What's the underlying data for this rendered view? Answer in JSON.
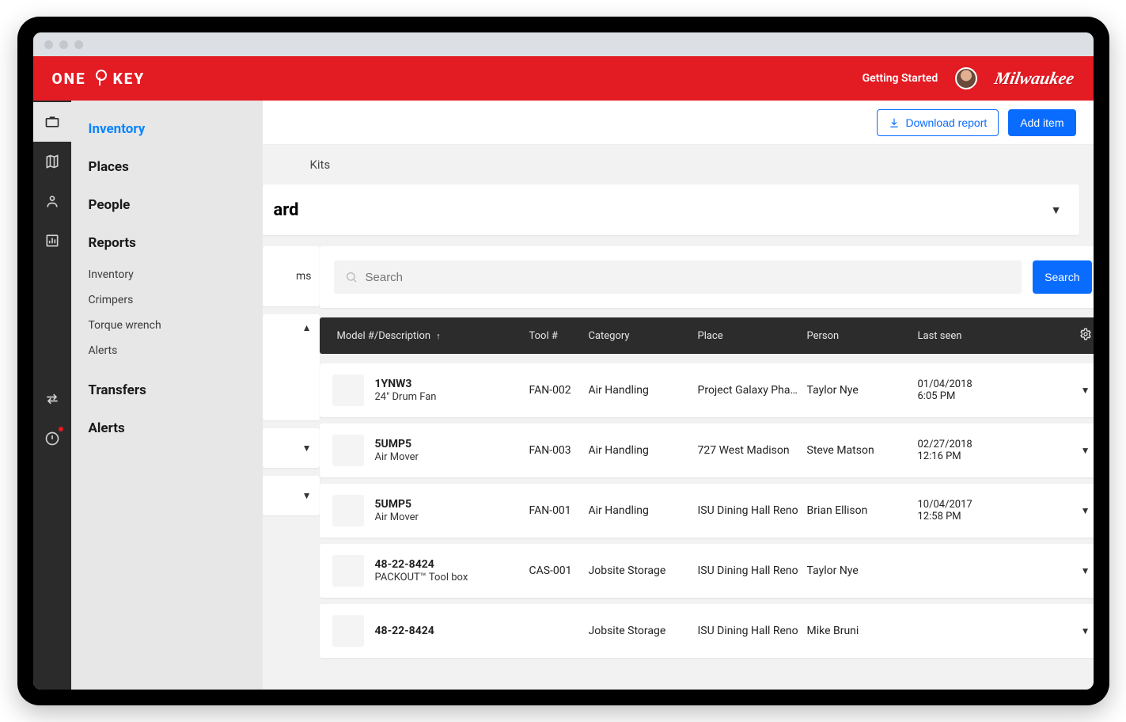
{
  "brand": {
    "name": "ONE-KEY",
    "mark": "Milwaukee"
  },
  "header": {
    "getting_started": "Getting Started"
  },
  "sidebar": {
    "items": [
      "Inventory",
      "Places",
      "People",
      "Reports"
    ],
    "report_subitems": [
      "Inventory",
      "Crimpers",
      "Torque wrench",
      "Alerts"
    ],
    "transfers": "Transfers",
    "alerts": "Alerts"
  },
  "toolbar": {
    "download_report": "Download report",
    "add_item": "Add item"
  },
  "subnav": {
    "kits": "Kits"
  },
  "heading": {
    "title_fragment": "ard"
  },
  "left_stubs": {
    "text1": "ms"
  },
  "search": {
    "placeholder": "Search",
    "button": "Search"
  },
  "columns": {
    "model": "Model #/Description",
    "tool": "Tool #",
    "category": "Category",
    "place": "Place",
    "person": "Person",
    "seen": "Last seen"
  },
  "rows": [
    {
      "model": "1YNW3",
      "desc": "24\" Drum Fan",
      "tool": "FAN-002",
      "category": "Air Handling",
      "place": "Project Galaxy Pha…",
      "person": "Taylor Nye",
      "seen_date": "01/04/2018",
      "seen_time": "6:05 PM"
    },
    {
      "model": "5UMP5",
      "desc": "Air Mover",
      "tool": "FAN-003",
      "category": "Air Handling",
      "place": "727 West Madison",
      "person": "Steve Matson",
      "seen_date": "02/27/2018",
      "seen_time": "12:16 PM"
    },
    {
      "model": "5UMP5",
      "desc": "Air Mover",
      "tool": "FAN-001",
      "category": "Air Handling",
      "place": "ISU Dining Hall Reno",
      "person": "Brian Ellison",
      "seen_date": "10/04/2017",
      "seen_time": "12:58 PM"
    },
    {
      "model": "48-22-8424",
      "desc": "PACKOUT™ Tool box",
      "tool": "CAS-001",
      "category": "Jobsite Storage",
      "place": "ISU Dining Hall Reno",
      "person": "Taylor Nye",
      "seen_date": "",
      "seen_time": ""
    },
    {
      "model": "48-22-8424",
      "desc": "",
      "tool": "",
      "category": "Jobsite Storage",
      "place": "ISU Dining Hall Reno",
      "person": "Mike Bruni",
      "seen_date": "",
      "seen_time": ""
    }
  ]
}
